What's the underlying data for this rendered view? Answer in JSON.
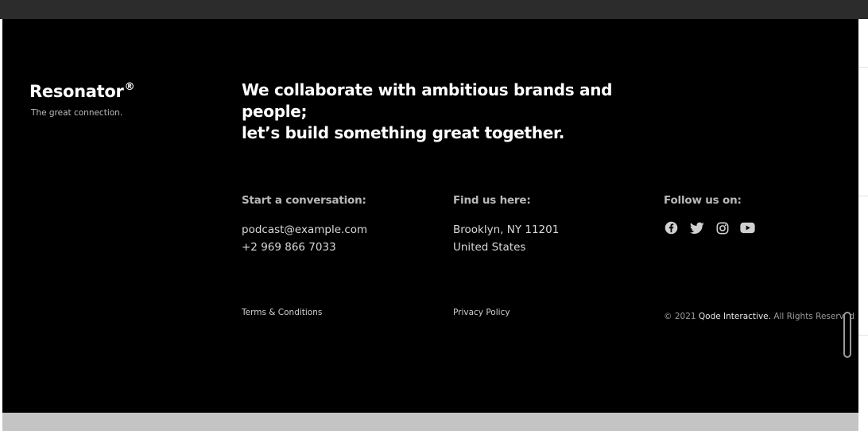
{
  "brand": {
    "name": "Resonator",
    "mark": "®",
    "tagline": "The great connection."
  },
  "headline": {
    "line1": "We collaborate with ambitious brands and people;",
    "line2": "let’s build something great together."
  },
  "contact": {
    "title": "Start a conversation:",
    "email": "podcast@example.com",
    "phone": "+2 969 866 7033"
  },
  "location": {
    "title": "Find us here:",
    "address": "Brooklyn, NY 11201",
    "country": "United States"
  },
  "social": {
    "title": "Follow us on:",
    "icons": [
      "facebook-icon",
      "twitter-icon",
      "instagram-icon",
      "youtube-icon"
    ]
  },
  "legal": {
    "terms": "Terms & Conditions",
    "privacy": "Privacy Policy",
    "copyright_prefix": "© 2021",
    "company": "Qode Interactive.",
    "rights": "All Rights Reserved"
  },
  "colors": {
    "footer_bg": "#000000",
    "top_bar": "#2c2c2c",
    "bottom_bar": "#c4c4c4",
    "text_primary": "#ffffff",
    "text_muted": "#b8b8b8"
  }
}
